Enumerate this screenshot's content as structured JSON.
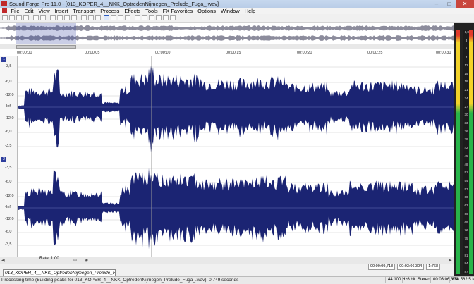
{
  "window": {
    "title": "Sound Forge Pro 11.0 - [013_KOPER_4__NKK_OptredenNijmegen_Prelude_Fuga_.wav]",
    "minimize": "–",
    "maximize": "□",
    "close": "✕"
  },
  "menu": [
    "File",
    "Edit",
    "View",
    "Insert",
    "Transport",
    "Process",
    "Effects",
    "Tools",
    "FX Favorites",
    "Options",
    "Window",
    "Help"
  ],
  "ruler": {
    "times": [
      "00:00:00",
      "00:00:05",
      "00:00:10",
      "00:00:15",
      "00:00:20",
      "00:00:25",
      "00:00:30"
    ]
  },
  "channels": [
    {
      "number": "1",
      "db_labels": [
        "-3,5",
        "-6,0",
        "-12,0",
        "-Inf",
        "-12,0",
        "-6,0",
        "-3,5"
      ]
    },
    {
      "number": "2",
      "db_labels": [
        "-3,5",
        "-6,0",
        "-12,0",
        "-Inf",
        "-12,0",
        "-6,0",
        "-3,5"
      ]
    }
  ],
  "transport": {
    "rate_label": "Rate: 1,00"
  },
  "selection": {
    "start": "00:00:09,718",
    "length": "00:03:06,304",
    "zoom": "1:768"
  },
  "document_tab": "013_KOPER_4__NKK_OptredenNijmegen_Prelude_Fuga_.wav",
  "statusbar": {
    "message": "Processing time (Building peaks for 013_KOPER_4__NKK_OptredenNijmegen_Prelude_Fuga_.wav): 0,749 seconds",
    "sample_rate": "44.100 Hz",
    "bit_depth": "16 bit",
    "channels": "Stereo",
    "length": "00:03:06,304",
    "disk_space": "858.562,5 MB"
  },
  "meters": {
    "ticks": [
      "-1,8",
      "3",
      "6",
      "9",
      "12",
      "15",
      "18",
      "21",
      "24",
      "27",
      "30",
      "33",
      "36",
      "39",
      "42",
      "45",
      "48",
      "51",
      "54",
      "57",
      "60",
      "63",
      "66",
      "69",
      "72",
      "75",
      "78",
      "81",
      "84",
      "87"
    ],
    "colors": {
      "top": "#e23b2b",
      "mid": "#f2d22a",
      "low": "#28b44a"
    }
  },
  "colors": {
    "waveform": "#1b2473",
    "overview_wave": "#8c8c9c",
    "cursor": "#888888"
  }
}
